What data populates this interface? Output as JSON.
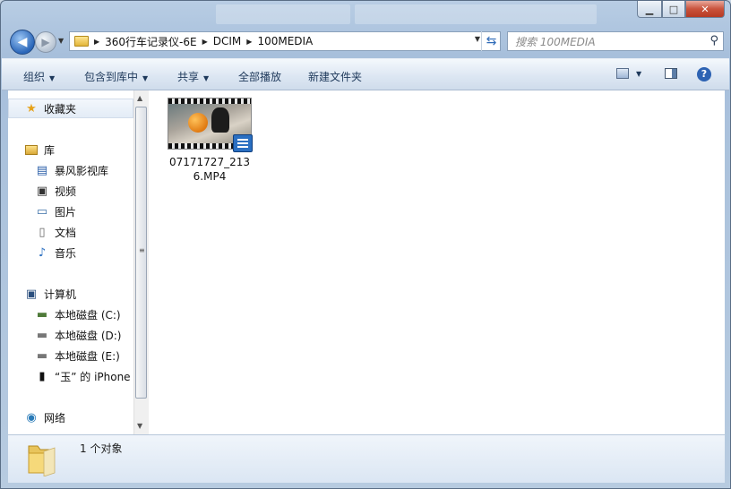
{
  "window": {
    "controls": {
      "minimize": "▁",
      "maximize": "□",
      "close": "✕"
    }
  },
  "address_bar": {
    "breadcrumbs": [
      "360行车记录仪-6E",
      "DCIM",
      "100MEDIA"
    ]
  },
  "search": {
    "placeholder": "搜索 100MEDIA"
  },
  "toolbar": {
    "organize": "组织",
    "include_in_library": "包含到库中",
    "share": "共享",
    "play_all": "全部播放",
    "new_folder": "新建文件夹"
  },
  "nav_pane": {
    "favorites": "收藏夹",
    "libraries": {
      "label": "库",
      "items": [
        "暴风影视库",
        "视频",
        "图片",
        "文档",
        "音乐"
      ]
    },
    "computer": {
      "label": "计算机",
      "items": [
        "本地磁盘 (C:)",
        "本地磁盘 (D:)",
        "本地磁盘 (E:)",
        "“玉” 的 iPhone"
      ]
    },
    "network": "网络"
  },
  "files": [
    {
      "name": "07171727_2136.MP4",
      "type": "video"
    }
  ],
  "status": {
    "item_count": "1 个对象"
  },
  "colors": {
    "accent": "#1e395b",
    "video_badge": "#2a6fc1"
  }
}
